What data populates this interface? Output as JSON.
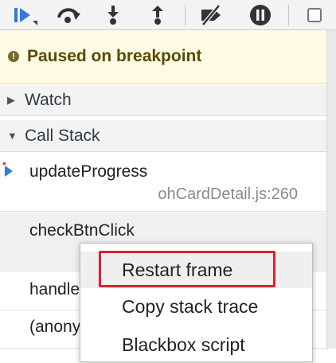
{
  "toolbar": {
    "buttons": [
      {
        "name": "resume-button",
        "icon": "resume-icon",
        "color": "#2f7bdc"
      },
      {
        "name": "step-over-button",
        "icon": "step-over-icon"
      },
      {
        "name": "step-into-button",
        "icon": "step-into-icon"
      },
      {
        "name": "step-out-button",
        "icon": "step-out-icon"
      },
      {
        "name": "deactivate-breakpoints-button",
        "icon": "deactivate-breakpoints-icon"
      },
      {
        "name": "pause-on-exceptions-button",
        "icon": "pause-exceptions-icon"
      }
    ],
    "checkbox_checked": false
  },
  "paused_banner": {
    "badge": "!",
    "text": "Paused on breakpoint",
    "bg": "#fffbe5"
  },
  "sections": {
    "watch": {
      "label": "Watch",
      "expanded": false
    },
    "call_stack": {
      "label": "Call Stack",
      "expanded": true
    }
  },
  "call_stack": {
    "frames": [
      {
        "name": "updateProgress",
        "location": "ohCardDetail.js:260",
        "current": true
      },
      {
        "name": "checkBtnClick",
        "location": ""
      },
      {
        "name": "handle",
        "location": ""
      },
      {
        "name": "(anony",
        "location": ""
      }
    ]
  },
  "context_menu": {
    "items": [
      {
        "label": "Restart frame",
        "highlighted": true
      },
      {
        "label": "Copy stack trace"
      },
      {
        "label": "Blackbox script"
      }
    ],
    "highlight_color": "#e0202a"
  }
}
